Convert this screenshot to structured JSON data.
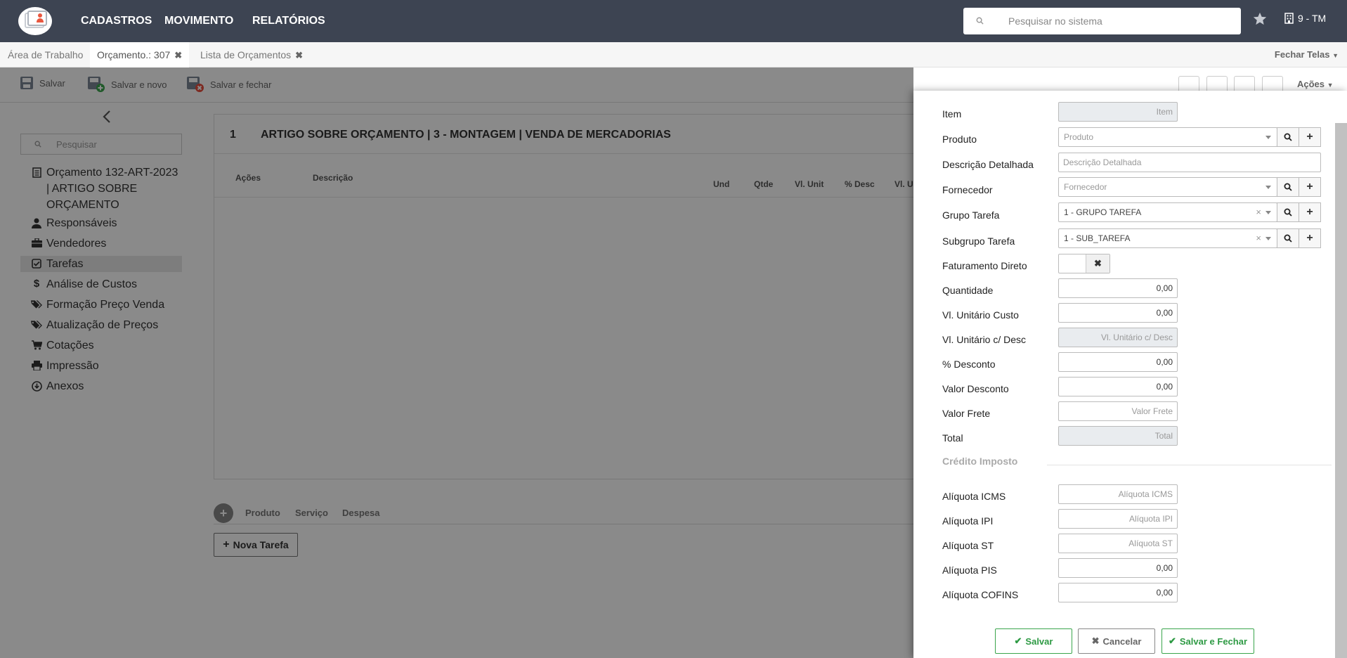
{
  "topbar": {
    "nav": [
      "CADASTROS",
      "MOVIMENTO",
      "RELATÓRIOS"
    ],
    "search_placeholder": "Pesquisar no sistema",
    "company": "9 - TM"
  },
  "tabs": [
    {
      "label": "Área de Trabalho",
      "closable": false
    },
    {
      "label": "Orçamento.: 307",
      "closable": true,
      "active": true
    },
    {
      "label": "Lista de Orçamentos",
      "closable": true
    }
  ],
  "fechar_telas": "Fechar Telas",
  "toolbar": {
    "salvar": "Salvar",
    "salvar_novo": "Salvar e novo",
    "salvar_fechar": "Salvar e fechar",
    "acoes": "Ações"
  },
  "sidebar": {
    "search_placeholder": "Pesquisar",
    "items": [
      {
        "label": "Orçamento 132-ART-2023 | ARTIGO SOBRE ORÇAMENTO",
        "icon": "document-icon"
      },
      {
        "label": "Responsáveis",
        "icon": "user-icon"
      },
      {
        "label": "Vendedores",
        "icon": "briefcase-icon"
      },
      {
        "label": "Tarefas",
        "icon": "check-square-icon",
        "active": true
      },
      {
        "label": "Análise de Custos",
        "icon": "dollar-icon"
      },
      {
        "label": "Formação Preço Venda",
        "icon": "tags-icon"
      },
      {
        "label": "Atualização de Preços",
        "icon": "tags-icon"
      },
      {
        "label": "Cotações",
        "icon": "cart-icon"
      },
      {
        "label": "Impressão",
        "icon": "print-icon"
      },
      {
        "label": "Anexos",
        "icon": "download-icon"
      }
    ]
  },
  "card": {
    "number": "1",
    "title": "ARTIGO SOBRE ORÇAMENTO | 3 - MONTAGEM | VENDA DE MERCADORIAS",
    "columns": [
      "Ações",
      "Descrição",
      "Und",
      "Qtde",
      "Vl. Unit",
      "% Desc",
      "Vl. U"
    ],
    "bottom_tabs": [
      "Produto",
      "Serviço",
      "Despesa"
    ],
    "nova_tarefa": "Nova Tarefa"
  },
  "form": {
    "item": {
      "label": "Item",
      "placeholder": "Item"
    },
    "produto": {
      "label": "Produto",
      "placeholder": "Produto"
    },
    "descricao": {
      "label": "Descrição Detalhada",
      "placeholder": "Descrição Detalhada"
    },
    "fornecedor": {
      "label": "Fornecedor",
      "placeholder": "Fornecedor"
    },
    "grupo": {
      "label": "Grupo Tarefa",
      "value": "1 - GRUPO TAREFA"
    },
    "subgrupo": {
      "label": "Subgrupo Tarefa",
      "value": "1 - SUB_TAREFA"
    },
    "faturamento": {
      "label": "Faturamento Direto"
    },
    "quantidade": {
      "label": "Quantidade",
      "value": "0,00"
    },
    "vl_custo": {
      "label": "Vl. Unitário Custo",
      "value": "0,00"
    },
    "vl_desc": {
      "label": "Vl. Unitário c/ Desc",
      "placeholder": "Vl. Unitário c/ Desc"
    },
    "pct_desc": {
      "label": "% Desconto",
      "value": "0,00"
    },
    "valor_desc": {
      "label": "Valor Desconto",
      "value": "0,00"
    },
    "valor_frete": {
      "label": "Valor Frete",
      "placeholder": "Valor Frete"
    },
    "total": {
      "label": "Total",
      "placeholder": "Total"
    },
    "credito_title": "Crédito Imposto",
    "icms": {
      "label": "Alíquota ICMS",
      "placeholder": "Alíquota ICMS"
    },
    "ipi": {
      "label": "Alíquota IPI",
      "placeholder": "Alíquota IPI"
    },
    "st": {
      "label": "Alíquota ST",
      "placeholder": "Alíquota ST"
    },
    "pis": {
      "label": "Alíquota PIS",
      "value": "0,00"
    },
    "cofins": {
      "label": "Alíquota COFINS",
      "value": "0,00"
    }
  },
  "footer": {
    "salvar": "Salvar",
    "cancelar": "Cancelar",
    "salvar_fechar": "Salvar e Fechar"
  },
  "colors": {
    "topbar": "#3d4452",
    "success": "#2e9a44",
    "accent": "#e9573f"
  }
}
